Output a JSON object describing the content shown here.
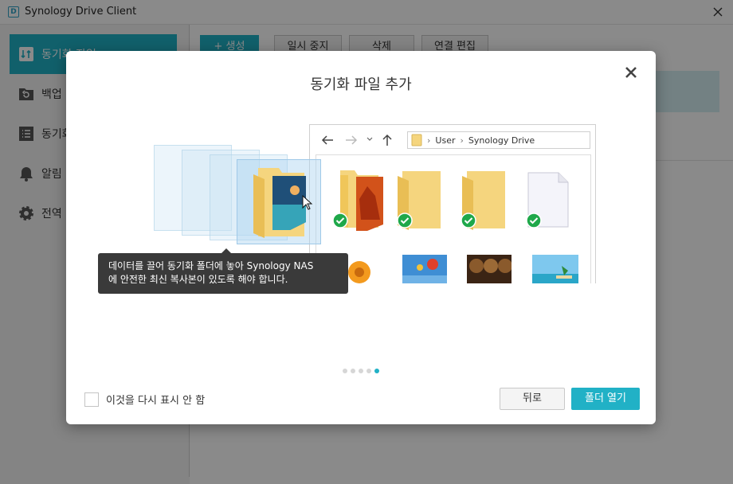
{
  "window": {
    "logo_text": "D",
    "title": "Synology Drive Client",
    "close_icon": "close-icon"
  },
  "sidebar": {
    "items": [
      {
        "label": "동기화 작업",
        "icon": "sync-icon",
        "active": true
      },
      {
        "label": "백업",
        "icon": "backup-icon",
        "active": false
      },
      {
        "label": "동기화",
        "icon": "list-icon",
        "active": false
      },
      {
        "label": "알림",
        "icon": "bell-icon",
        "active": false
      },
      {
        "label": "전역",
        "icon": "gear-icon",
        "active": false
      }
    ]
  },
  "toolbar": {
    "create_label": "+ 생성",
    "pause_label": "일시 중지",
    "delete_label": "삭제",
    "edit_label": "연결 편집"
  },
  "dialog": {
    "title": "동기화 파일 추가",
    "close_icon": "close-icon",
    "explorer": {
      "path": [
        "User",
        "Synology Drive"
      ],
      "nav_icons": [
        "back-arrow-icon",
        "forward-arrow-icon",
        "chevron-down-icon",
        "up-arrow-icon"
      ],
      "status_icon": "check-icon"
    },
    "tooltip": {
      "line1": "데이터를 끌어 동기화 폴더에 놓아 Synology NAS",
      "line2": "에 안전한 최신 복사본이 있도록 해야 합니다."
    },
    "pager": {
      "total": 5,
      "current": 5
    },
    "dont_show_label": "이것을 다시 표시 안 함",
    "back_label": "뒤로",
    "open_folder_label": "폴더 열기"
  },
  "colors": {
    "accent": "#21b1c6",
    "check_green": "#1fa84a",
    "folder_yellow": "#f5d57e"
  }
}
